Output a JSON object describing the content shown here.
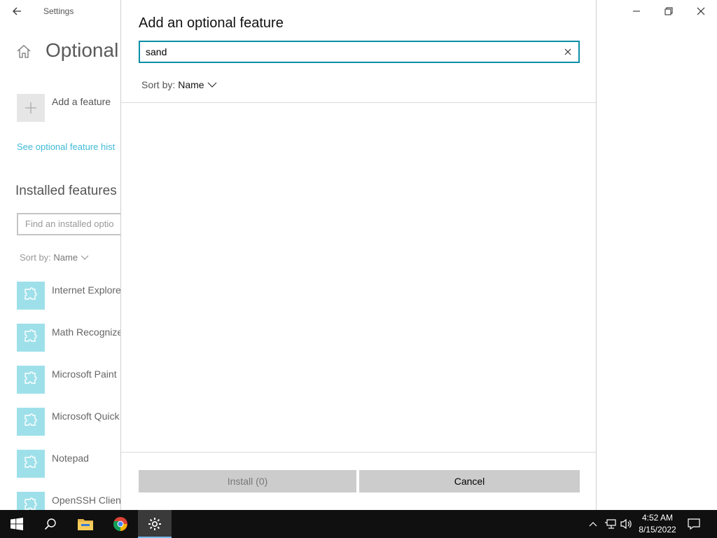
{
  "background_window": {
    "app_title": "Settings",
    "page_title": "Optional",
    "add_feature_label": "Add a feature",
    "history_link": "See optional feature hist",
    "installed_title": "Installed features",
    "find_placeholder": "Find an installed optio",
    "sort_label": "Sort by:",
    "sort_value": "Name",
    "features": [
      {
        "name": "Internet Explore"
      },
      {
        "name": "Math Recognize"
      },
      {
        "name": "Microsoft Paint"
      },
      {
        "name": "Microsoft Quick"
      },
      {
        "name": "Notepad"
      },
      {
        "name": "OpenSSH Client"
      }
    ],
    "feature_icon": "puzzle-icon"
  },
  "dialog": {
    "title": "Add an optional feature",
    "search_value": "sand",
    "sort_label": "Sort by:",
    "sort_value": "Name",
    "install_label": "Install (0)",
    "cancel_label": "Cancel",
    "accent_color": "#0b8ea8"
  },
  "taskbar": {
    "time": "4:52 AM",
    "date": "8/15/2022",
    "pinned": [
      "start-icon",
      "search-icon",
      "file-explorer-icon",
      "chrome-icon",
      "settings-icon"
    ],
    "tray": [
      "chevron-up-icon",
      "network-icon",
      "volume-icon",
      "notification-icon"
    ]
  },
  "colors": {
    "feature_icon_bg": "#9ee0ea",
    "link": "#00a3c9",
    "taskbar": "#101010"
  }
}
